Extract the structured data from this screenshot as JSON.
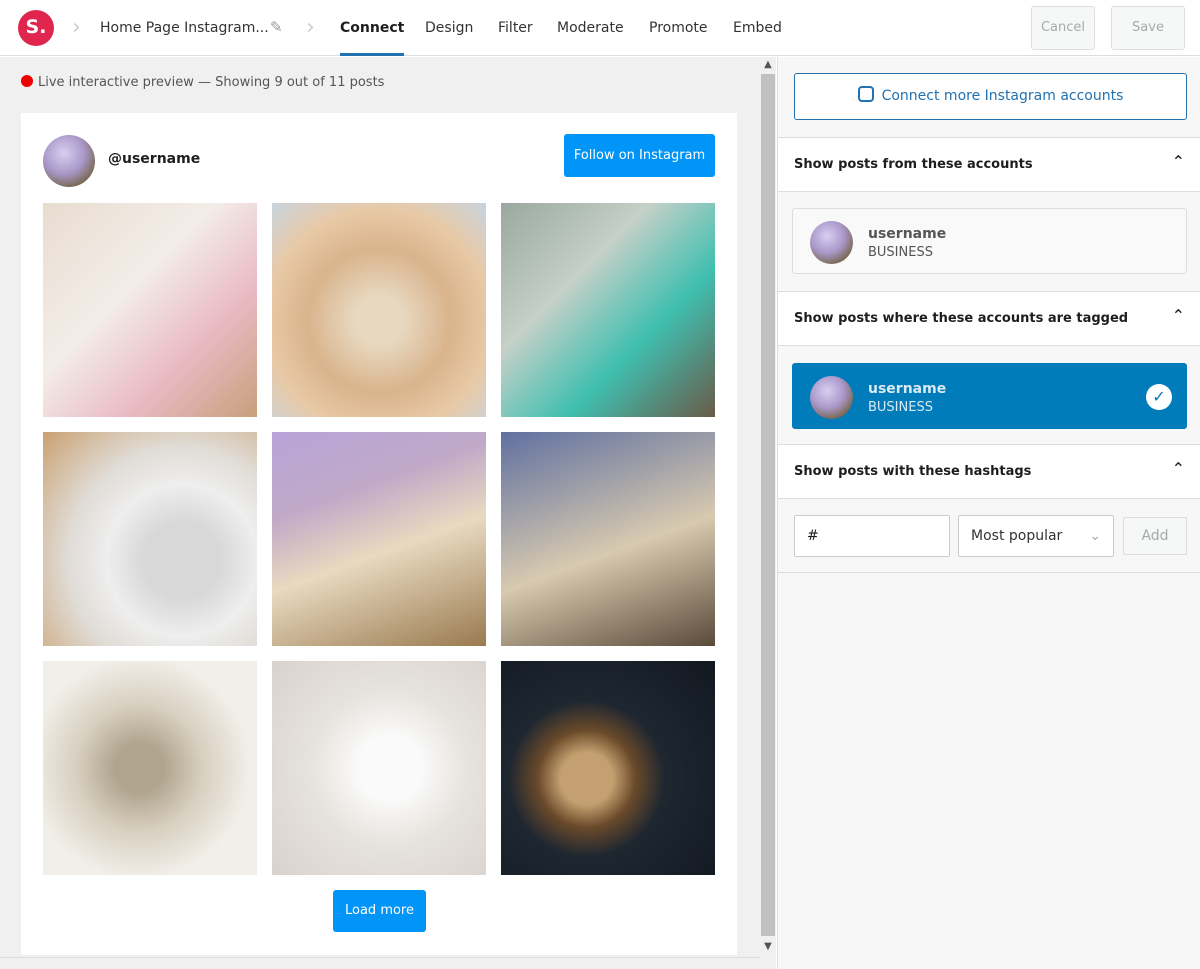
{
  "header": {
    "logo": "S.",
    "breadcrumb": "Home Page Instagram...",
    "tabs": [
      "Connect",
      "Design",
      "Filter",
      "Moderate",
      "Promote",
      "Embed"
    ],
    "active_tab": "Connect",
    "cancel": "Cancel",
    "save": "Save"
  },
  "preview": {
    "status": "Live interactive preview — Showing 9 out of 11 posts",
    "username": "@username",
    "follow": "Follow on Instagram",
    "load_more": "Load more",
    "posts": [
      "soap bars with dried flowers on floral paper",
      "stack of colorful soap bars",
      "rows of teal and green marbled soaps",
      "shaving brush and soap",
      "wrapped soaps with twine in wooden bowl",
      "wrapped soaps with lavender",
      "assorted natural soap pieces",
      "white soap bars on dish",
      "round soap on dark background"
    ]
  },
  "sidebar": {
    "connect_more": "Connect more Instagram accounts",
    "sections": [
      {
        "title": "Show posts from these accounts",
        "account": {
          "name": "username",
          "type": "BUSINESS",
          "selected": false
        }
      },
      {
        "title": "Show posts where these accounts are tagged",
        "account": {
          "name": "username",
          "type": "BUSINESS",
          "selected": true
        }
      },
      {
        "title": "Show posts with these hashtags"
      }
    ],
    "hashtag": {
      "value": "#",
      "sort": "Most popular",
      "add": "Add"
    }
  },
  "colors": {
    "brand": "#e0254f",
    "accent": "#007cba",
    "instagram_button": "#0095f6",
    "live_dot": "#ee0000"
  }
}
